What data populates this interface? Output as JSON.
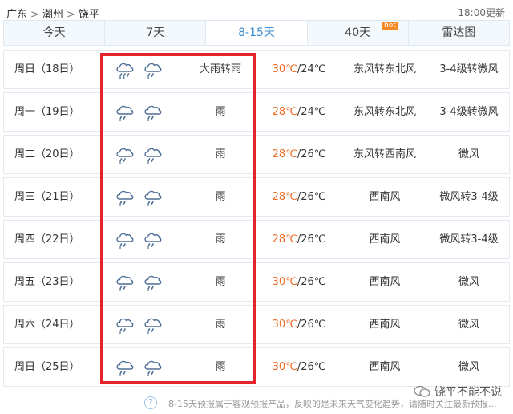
{
  "breadcrumb": [
    "广东",
    "潮州",
    "饶平"
  ],
  "breadcrumb_sep": ">",
  "update_time": "18:00更新",
  "tabs": [
    {
      "label": "今天"
    },
    {
      "label": "7天"
    },
    {
      "label": "8-15天"
    },
    {
      "label": "40天",
      "badge": "hot"
    },
    {
      "label": "雷达图"
    }
  ],
  "active_tab": "8-15天",
  "rows": [
    {
      "date": "周日（18日）",
      "weather": "大雨转雨",
      "high": "30℃",
      "low": "/24℃",
      "wind": "东风转东北风",
      "level": "3-4级转微风",
      "icons": [
        "heavy-rain-icon",
        "rain-icon"
      ]
    },
    {
      "date": "周一（19日）",
      "weather": "雨",
      "high": "28℃",
      "low": "/24℃",
      "wind": "东风转东北风",
      "level": "3-4级转微风",
      "icons": [
        "rain-icon",
        "rain-icon"
      ]
    },
    {
      "date": "周二（20日）",
      "weather": "雨",
      "high": "28℃",
      "low": "/26℃",
      "wind": "东风转西南风",
      "level": "微风",
      "icons": [
        "rain-icon",
        "rain-icon"
      ]
    },
    {
      "date": "周三（21日）",
      "weather": "雨",
      "high": "28℃",
      "low": "/26℃",
      "wind": "西南风",
      "level": "微风转3-4级",
      "icons": [
        "rain-icon",
        "rain-icon"
      ]
    },
    {
      "date": "周四（22日）",
      "weather": "雨",
      "high": "28℃",
      "low": "/26℃",
      "wind": "西南风",
      "level": "微风转3-4级",
      "icons": [
        "rain-icon",
        "rain-icon"
      ]
    },
    {
      "date": "周五（23日）",
      "weather": "雨",
      "high": "30℃",
      "low": "/26℃",
      "wind": "西南风",
      "level": "微风",
      "icons": [
        "rain-icon",
        "rain-icon"
      ]
    },
    {
      "date": "周六（24日）",
      "weather": "雨",
      "high": "30℃",
      "low": "/26℃",
      "wind": "西南风",
      "level": "微风",
      "icons": [
        "rain-icon",
        "rain-icon"
      ]
    },
    {
      "date": "周日（25日）",
      "weather": "雨",
      "high": "30℃",
      "low": "/26℃",
      "wind": "西南风",
      "level": "微风",
      "icons": [
        "rain-icon",
        "rain-icon"
      ]
    }
  ],
  "footer_note": "8-15天预报属于客观预报产品，反映的是未来天气变化趋势，请随时关注最新预报...",
  "help_icon": "?",
  "watermark": "饶平不能不说",
  "colors": {
    "accent": "#3a8ed6",
    "high_temp": "#ec6c28",
    "highlight_box": "#e4242a",
    "hot_badge": "#f58a25"
  }
}
